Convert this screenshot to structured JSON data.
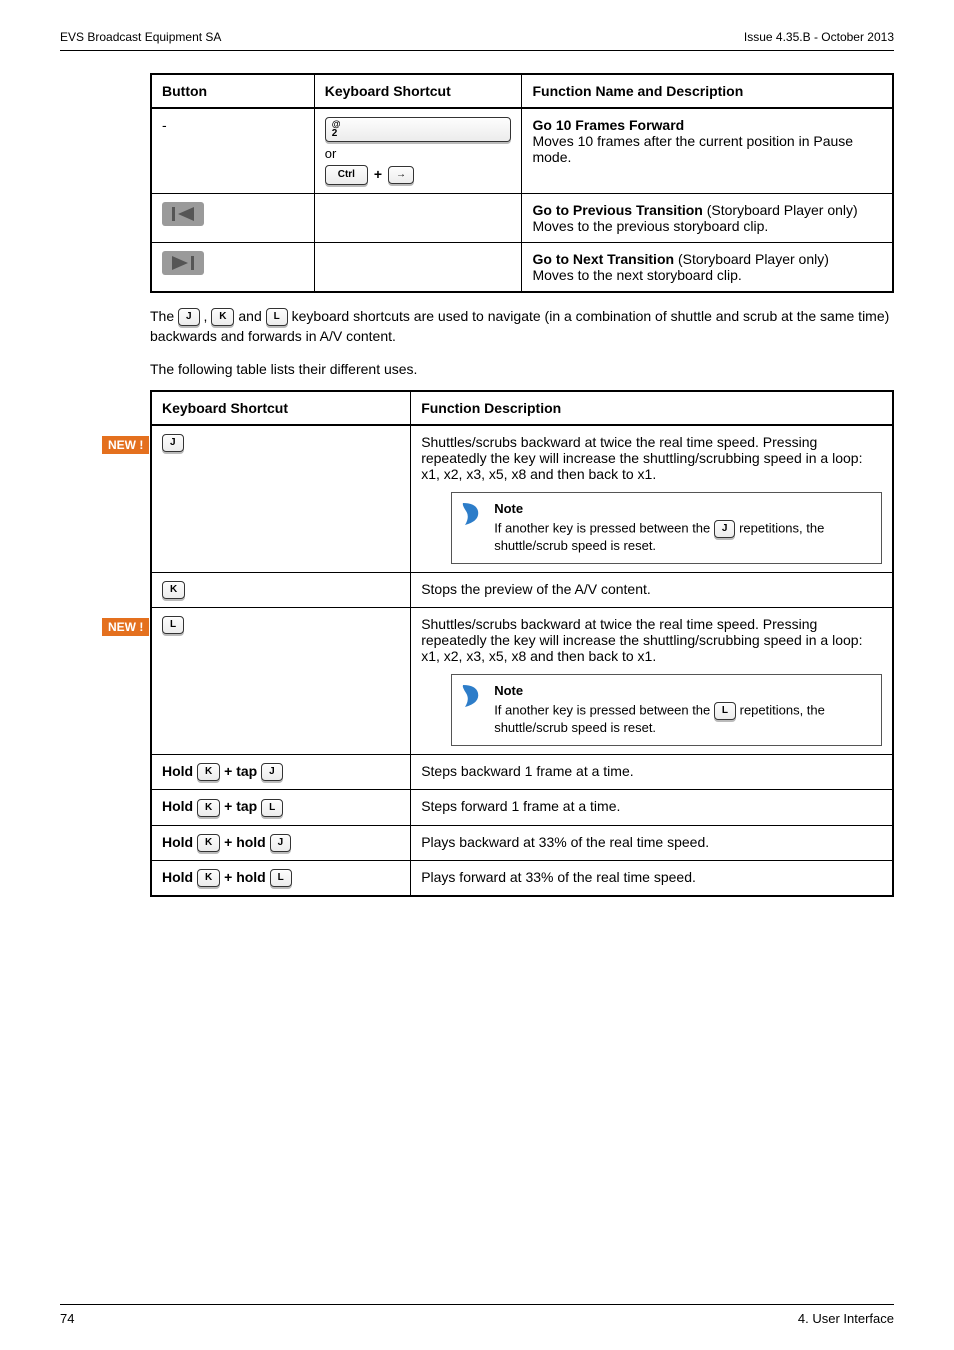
{
  "header": {
    "left": "EVS Broadcast Equipment SA",
    "right": "Issue 4.35.B - October 2013"
  },
  "footer": {
    "left": "74",
    "right": "4. User Interface"
  },
  "table1": {
    "headers": {
      "button": "Button",
      "shortcut": "Keyboard Shortcut",
      "desc": "Function Name and Description"
    },
    "rows": [
      {
        "button": "-",
        "shortcut_or": "or",
        "shortcut_plus": "+",
        "desc_title": "Go 10 Frames Forward",
        "desc_rest": "Moves 10 frames after the current position in Pause mode."
      },
      {
        "desc_title": "Go to Previous Transition",
        "desc_paren": "(Storyboard Player only)",
        "desc_rest": "Moves to the previous storyboard clip."
      },
      {
        "desc_title": "Go to Next Transition",
        "desc_paren": "(Storyboard Player only)",
        "desc_rest": "Moves to the next storyboard clip."
      }
    ]
  },
  "paragraph1_a": "The ",
  "paragraph1_b": ", ",
  "paragraph1_c": " and ",
  "paragraph1_d": " keyboard shortcuts are used to navigate (in a combination of shuttle and scrub at the same time) backwards and forwards in A/V content.",
  "paragraph2": "The following table lists their different uses.",
  "keys": {
    "j": "J",
    "k": "K",
    "l": "L",
    "ctrl": "Ctrl",
    "arrow_right": "→",
    "two_at_top": "@",
    "two_at_bot": "2"
  },
  "badges": {
    "new": "NEW !"
  },
  "combos": {
    "hold": "Hold",
    "plus_tap": "+ tap",
    "plus_hold": "+ hold"
  },
  "table2": {
    "headers": {
      "shortcut": "Keyboard Shortcut",
      "desc": "Function Description"
    },
    "rows": {
      "j": "Shuttles/scrubs backward at twice the real time speed. Pressing repeatedly the key will increase the shuttling/scrubbing speed in a loop: x1, x2, x3, x5, x8 and then back to x1.",
      "note_title": "Note",
      "j_note_a": "If another key is pressed between the ",
      "j_note_b": " repetitions, the shuttle/scrub speed is reset.",
      "k": "Stops the preview of the A/V content.",
      "l": "Shuttles/scrubs backward at twice the real time speed. Pressing repeatedly the key will increase the shuttling/scrubbing speed in a loop: x1, x2, x3, x5, x8 and then back to x1.",
      "l_note_a": "If another key is pressed between the ",
      "l_note_b": " repetitions, the shuttle/scrub speed is reset.",
      "hold_k_tap_j": "Steps backward 1 frame at a time.",
      "hold_k_tap_l": "Steps forward 1 frame at a time.",
      "hold_k_hold_j": "Plays backward at 33% of the real time speed.",
      "hold_k_hold_l": "Plays forward at 33% of the real time speed."
    }
  }
}
